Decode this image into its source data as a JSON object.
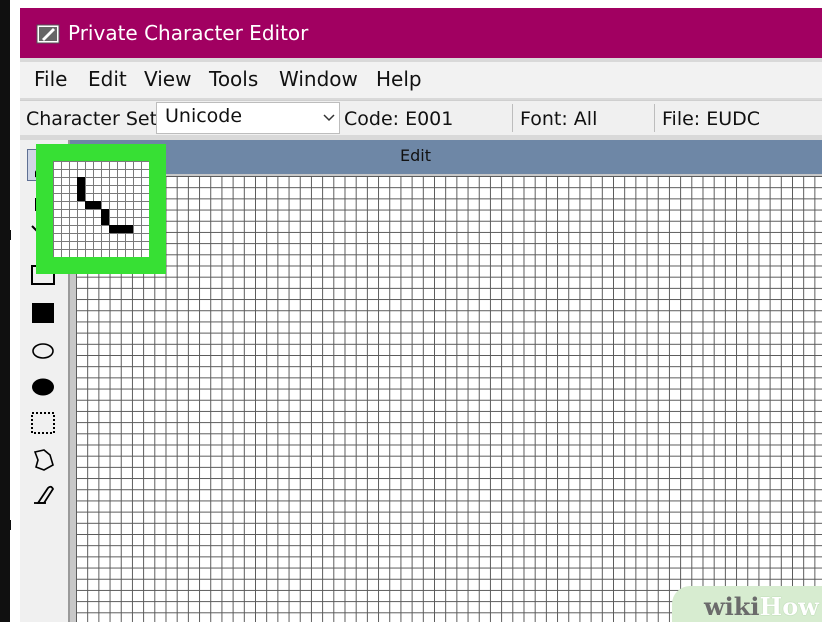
{
  "window": {
    "title": "Private Character Editor"
  },
  "menu": {
    "items": [
      "File",
      "Edit",
      "View",
      "Tools",
      "Window",
      "Help"
    ]
  },
  "toolbar": {
    "charset_label": "Character Set:",
    "charset_value": "Unicode",
    "code": "Code: E001",
    "font": "Font: All",
    "file": "File: EUDC"
  },
  "tools": [
    {
      "name": "pencil-icon",
      "active": true
    },
    {
      "name": "brush-icon"
    },
    {
      "name": "line-icon"
    },
    {
      "name": "hollow-rectangle-icon"
    },
    {
      "name": "filled-rectangle-icon"
    },
    {
      "name": "hollow-ellipse-icon"
    },
    {
      "name": "filled-ellipse-icon"
    },
    {
      "name": "rectangular-selection-icon"
    },
    {
      "name": "freeform-selection-icon"
    },
    {
      "name": "eraser-icon"
    }
  ],
  "edit_panel": {
    "header": "Edit"
  },
  "watermark": {
    "part1": "wiki",
    "part2": "How"
  },
  "colors": {
    "titlebar": "#a10061",
    "highlight": "#37e034",
    "edit_header": "#6e87a6"
  }
}
